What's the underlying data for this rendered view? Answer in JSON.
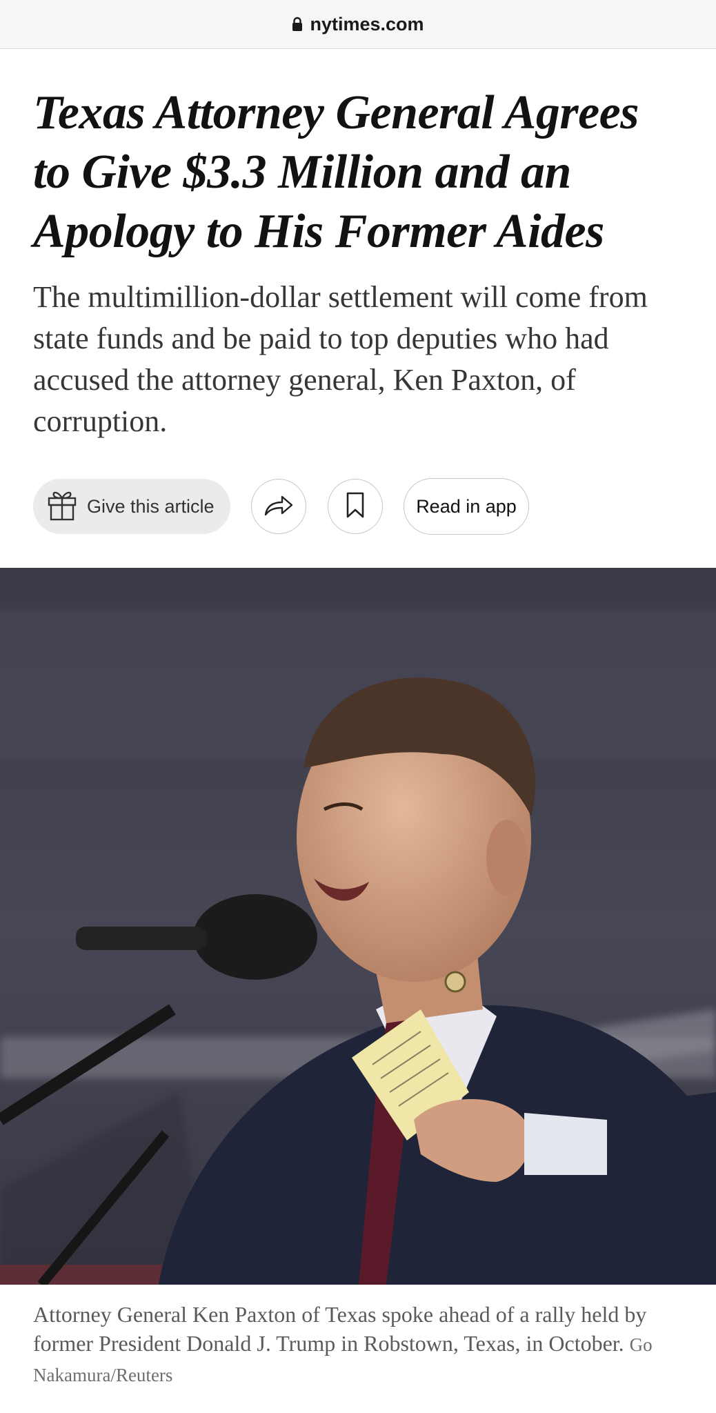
{
  "browser": {
    "url": "nytimes.com"
  },
  "article": {
    "headline": "Texas Attorney General Agrees to Give $3.3 Million and an Apology to His Former Aides",
    "summary": "The multimillion-dollar settlement will come from state funds and be paid to top deputies who had accused the attorney general, Ken Paxton, of corruption."
  },
  "actions": {
    "gift_label": "Give this article",
    "read_in_app_label": "Read in app"
  },
  "photo": {
    "caption": "Attorney General Ken Paxton of Texas spoke ahead of a rally held by former President Donald J. Trump in Robstown, Texas, in October.",
    "credit": "Go Nakamura/Reuters"
  },
  "colors": {
    "text": "#121212",
    "summary": "#363636",
    "caption": "#5a5a5a",
    "button_fill": "#ebebeb",
    "button_border": "#c7c7c7"
  }
}
